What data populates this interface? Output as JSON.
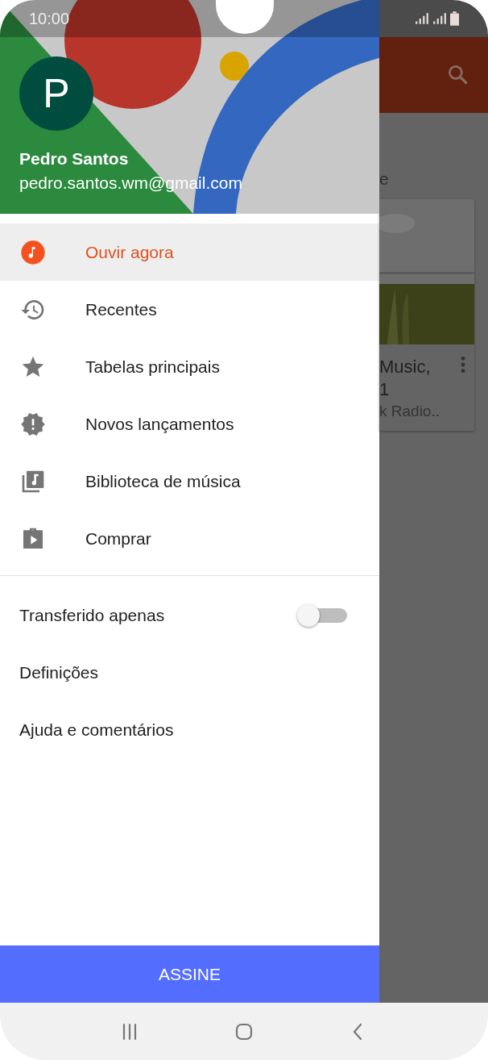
{
  "status_bar": {
    "time": "10:00"
  },
  "drawer": {
    "account": {
      "initial": "P",
      "name": "Pedro Santos",
      "email": "pedro.santos.wm@gmail.com"
    },
    "items": [
      {
        "label": "Ouvir agora",
        "selected": true
      },
      {
        "label": "Recentes",
        "selected": false
      },
      {
        "label": "Tabelas principais",
        "selected": false
      },
      {
        "label": "Novos lançamentos",
        "selected": false
      },
      {
        "label": "Biblioteca de música",
        "selected": false
      },
      {
        "label": "Comprar",
        "selected": false
      }
    ],
    "settings": [
      {
        "label": "Transferido apenas",
        "kind": "toggle",
        "on": false
      },
      {
        "label": "Definições",
        "kind": "link"
      },
      {
        "label": "Ajuda e comentários",
        "kind": "link"
      }
    ],
    "subscribe_button": "ASSINE"
  },
  "background_screen": {
    "heading_fragment": "e",
    "card": {
      "title_line_1": "Music,",
      "title_line_2": "1",
      "subtitle": "k Radio.."
    }
  }
}
